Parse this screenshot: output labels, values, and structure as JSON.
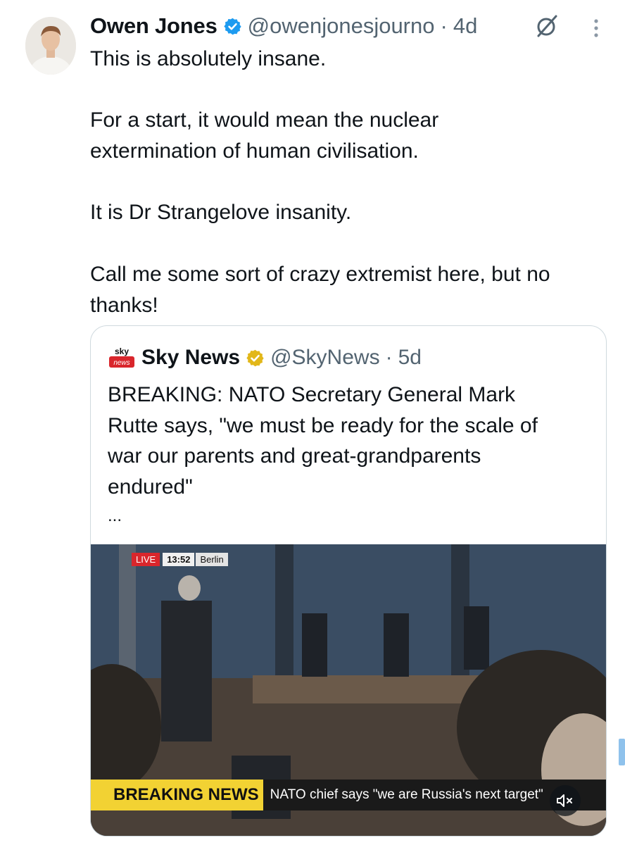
{
  "tweet": {
    "author_name": "Owen Jones",
    "author_handle": "@owenjonesjourno",
    "separator": "·",
    "time": "4d",
    "text_lines": [
      "This is absolutely insane.",
      "",
      "For a start, it would mean the nuclear",
      "extermination of human civilisation.",
      "",
      "It is Dr Strangelove insanity.",
      "",
      "Call me some sort of crazy extremist here, but no",
      "thanks!"
    ]
  },
  "quote": {
    "logo_text_top": "sky",
    "logo_text_bottom": "news",
    "author_name": "Sky News",
    "author_handle": "@SkyNews",
    "separator": "·",
    "time": "5d",
    "text_lines": [
      "BREAKING: NATO Secretary General Mark",
      "Rutte says, \"we must be ready for the scale of",
      "war our parents and great-grandparents",
      "endured\""
    ],
    "ellipsis": "...",
    "media": {
      "live_label": "LIVE",
      "live_time": "13:52",
      "live_location": "Berlin",
      "breaking_label": "BREAKING NEWS",
      "ticker": "NATO chief says \"we are Russia's next target\""
    }
  },
  "colors": {
    "verified_blue": "#1d9bf0",
    "verified_gold": "#e2b719",
    "live_red": "#d9262c",
    "breaking_yellow": "#f2d233",
    "muted_text": "#536471",
    "border": "#cfd9de"
  },
  "icons": [
    "verified-badge-icon",
    "grok-icon",
    "more-icon",
    "sky-news-logo",
    "gold-verified-badge-icon",
    "mute-icon"
  ]
}
